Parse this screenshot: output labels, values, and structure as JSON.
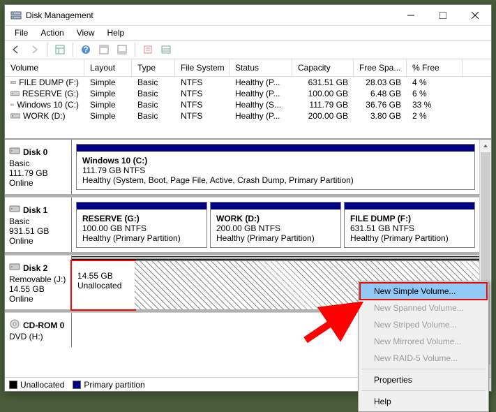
{
  "window": {
    "title": "Disk Management"
  },
  "menu": {
    "file": "File",
    "action": "Action",
    "view": "View",
    "help": "Help"
  },
  "columns": [
    "Volume",
    "Layout",
    "Type",
    "File System",
    "Status",
    "Capacity",
    "Free Spa...",
    "% Free"
  ],
  "volumes": [
    {
      "name": "FILE DUMP (F:)",
      "layout": "Simple",
      "type": "Basic",
      "fs": "NTFS",
      "status": "Healthy (P...",
      "capacity": "631.51 GB",
      "free": "28.03 GB",
      "pct": "4 %"
    },
    {
      "name": "RESERVE (G:)",
      "layout": "Simple",
      "type": "Basic",
      "fs": "NTFS",
      "status": "Healthy (P...",
      "capacity": "100.00 GB",
      "free": "6.48 GB",
      "pct": "6 %"
    },
    {
      "name": "Windows 10 (C:)",
      "layout": "Simple",
      "type": "Basic",
      "fs": "NTFS",
      "status": "Healthy (S...",
      "capacity": "111.79 GB",
      "free": "36.76 GB",
      "pct": "33 %"
    },
    {
      "name": "WORK (D:)",
      "layout": "Simple",
      "type": "Basic",
      "fs": "NTFS",
      "status": "Healthy (P...",
      "capacity": "200.00 GB",
      "free": "3.80 GB",
      "pct": "2 %"
    }
  ],
  "disks": [
    {
      "name": "Disk 0",
      "type": "Basic",
      "size": "111.79 GB",
      "status": "Online",
      "partitions": [
        {
          "title": "Windows 10  (C:)",
          "sub": "111.79 GB NTFS",
          "detail": "Healthy (System, Boot, Page File, Active, Crash Dump, Primary Partition)",
          "bar": "#000080"
        }
      ]
    },
    {
      "name": "Disk 1",
      "type": "Basic",
      "size": "931.51 GB",
      "status": "Online",
      "partitions": [
        {
          "title": "RESERVE  (G:)",
          "sub": "100.00 GB NTFS",
          "detail": "Healthy (Primary Partition)",
          "bar": "#000080"
        },
        {
          "title": "WORK  (D:)",
          "sub": "200.00 GB NTFS",
          "detail": "Healthy (Primary Partition)",
          "bar": "#000080"
        },
        {
          "title": "FILE DUMP  (F:)",
          "sub": "631.51 GB NTFS",
          "detail": "Healthy (Primary Partition)",
          "bar": "#000080"
        }
      ]
    },
    {
      "name": "Disk 2",
      "type": "Removable (J:)",
      "size": "14.55 GB",
      "status": "Online",
      "partitions": [
        {
          "title": "",
          "sub": "14.55 GB",
          "detail": "Unallocated",
          "bar": "hatch",
          "unalloc": true
        }
      ]
    },
    {
      "name": "CD-ROM 0",
      "type": "DVD (H:)",
      "size": "",
      "status": "",
      "partitions": []
    }
  ],
  "legend": {
    "unalloc": "Unallocated",
    "primary": "Primary partition"
  },
  "context_menu": {
    "items": [
      {
        "label": "New Simple Volume...",
        "enabled": true,
        "highlight": true
      },
      {
        "label": "New Spanned Volume...",
        "enabled": false
      },
      {
        "label": "New Striped Volume...",
        "enabled": false
      },
      {
        "label": "New Mirrored Volume...",
        "enabled": false
      },
      {
        "label": "New RAID-5 Volume...",
        "enabled": false
      },
      {
        "sep": true
      },
      {
        "label": "Properties",
        "enabled": true
      },
      {
        "sep": true
      },
      {
        "label": "Help",
        "enabled": true
      }
    ]
  }
}
